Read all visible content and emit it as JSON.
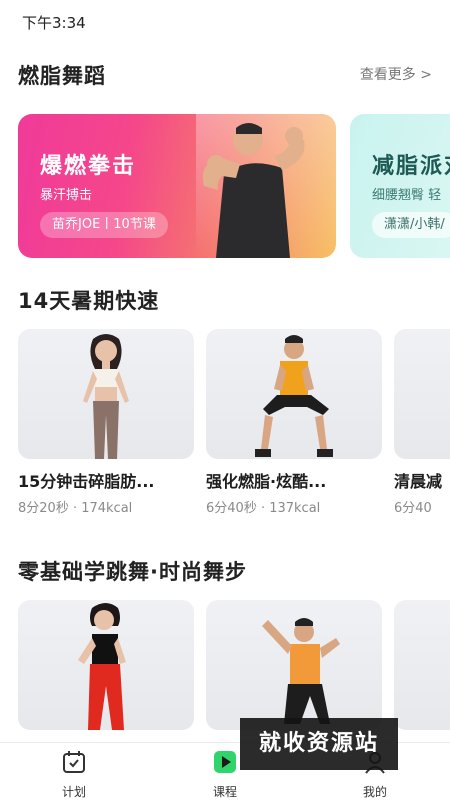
{
  "status_bar": {
    "time": "下午3:34"
  },
  "section_dance": {
    "title": "燃脂舞蹈",
    "see_more": "查看更多 >"
  },
  "banners": [
    {
      "title": "爆燃拳击",
      "subtitle": "暴汗搏击",
      "tag": "苗乔JOE丨10节课"
    },
    {
      "title": "减脂派对",
      "subtitle": "细腰翘臀 轻",
      "tag": "潇潇/小韩/"
    }
  ],
  "section_summer": {
    "title": "14天暑期快速"
  },
  "summer_cards": [
    {
      "title": "15分钟击碎脂肪...",
      "meta": "8分20秒 · 174kcal"
    },
    {
      "title": "强化燃脂·炫酷...",
      "meta": "6分40秒 · 137kcal"
    },
    {
      "title": "清晨减",
      "meta": "6分40"
    }
  ],
  "section_beginner": {
    "title": "零基础学跳舞·时尚舞步"
  },
  "beginner_cards": [
    {
      "title": "",
      "meta": ""
    },
    {
      "title": "",
      "meta": ""
    },
    {
      "title": "",
      "meta": ""
    }
  ],
  "bottom_nav": {
    "items": [
      {
        "label": "计划",
        "icon": "calendar-icon"
      },
      {
        "label": "课程",
        "icon": "play-icon"
      },
      {
        "label": "我的",
        "icon": "profile-icon"
      }
    ]
  },
  "watermark": "就收资源站",
  "colors": {
    "accent_green": "#2fd56a",
    "banner_pink": "#f03a9a",
    "banner_teal": "#c9f3ef"
  }
}
